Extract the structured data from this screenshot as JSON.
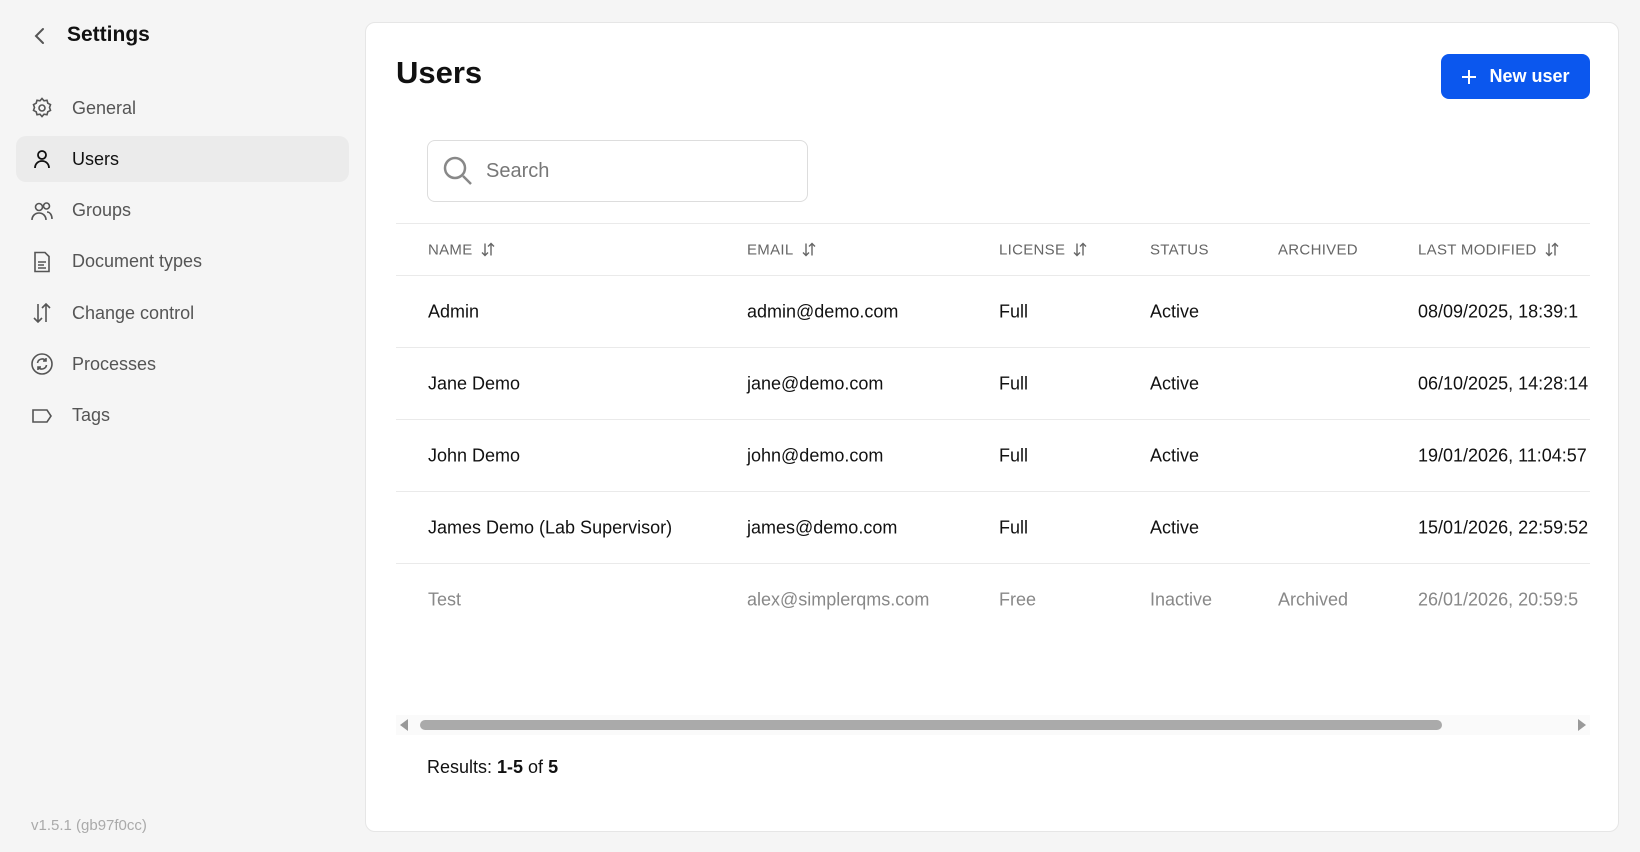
{
  "sidebar": {
    "title": "Settings",
    "version": "v1.5.1 (gb97f0cc)",
    "items": [
      {
        "label": "General",
        "icon": "gear-icon"
      },
      {
        "label": "Users",
        "icon": "user-icon",
        "active": true
      },
      {
        "label": "Groups",
        "icon": "users-icon"
      },
      {
        "label": "Document types",
        "icon": "document-icon"
      },
      {
        "label": "Change control",
        "icon": "sort-arrows-icon"
      },
      {
        "label": "Processes",
        "icon": "refresh-icon"
      },
      {
        "label": "Tags",
        "icon": "tag-icon"
      }
    ]
  },
  "main": {
    "title": "Users",
    "new_user_label": "New user",
    "search_placeholder": "Search",
    "columns": [
      "NAME",
      "EMAIL",
      "LICENSE",
      "STATUS",
      "ARCHIVED",
      "LAST MODIFIED"
    ],
    "rows": [
      [
        "Admin",
        "admin@demo.com",
        "Full",
        "Active",
        "",
        "08/09/2025, 18:39:1"
      ],
      [
        "Jane Demo",
        "jane@demo.com",
        "Full",
        "Active",
        "",
        "06/10/2025, 14:28:14"
      ],
      [
        "John Demo",
        "john@demo.com",
        "Full",
        "Active",
        "",
        "19/01/2026, 11:04:57"
      ],
      [
        "James Demo (Lab Supervisor)",
        "james@demo.com",
        "Full",
        "Active",
        "",
        "15/01/2026, 22:59:52"
      ],
      [
        "Test",
        "alex@simplerqms.com",
        "Free",
        "Inactive",
        "Archived",
        "26/01/2026, 20:59:5"
      ]
    ],
    "results": {
      "prefix": "Results: ",
      "range": "1-5",
      "of": " of ",
      "total": "5"
    }
  },
  "colors": {
    "accent": "#0b57ee"
  }
}
